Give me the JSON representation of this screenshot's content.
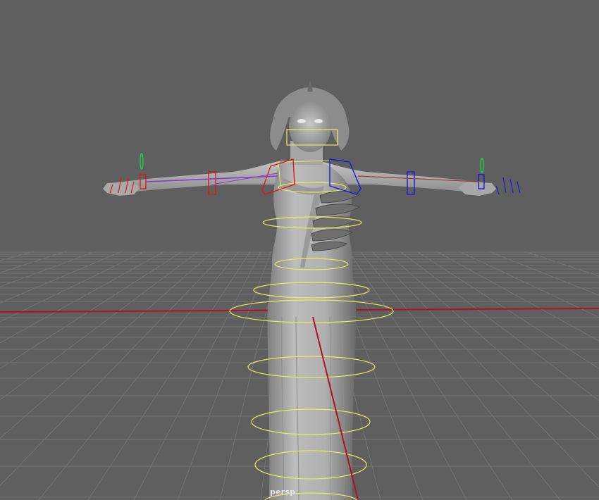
{
  "viewport": {
    "camera_label": "persp",
    "background_color": "#5f5f5f",
    "grid_color": "#727272",
    "axis_color": "#b0102a",
    "model_color": "#b4b4b4",
    "controls": {
      "spine_color": "#e8e860",
      "left_arm_color": "#e01818",
      "right_arm_color": "#1a1ad8",
      "pole_vector_color": "#20d040",
      "wrist_pole_color": "#40e070"
    }
  },
  "toolbar_strip": {
    "accent_color": "#5c87ad"
  }
}
